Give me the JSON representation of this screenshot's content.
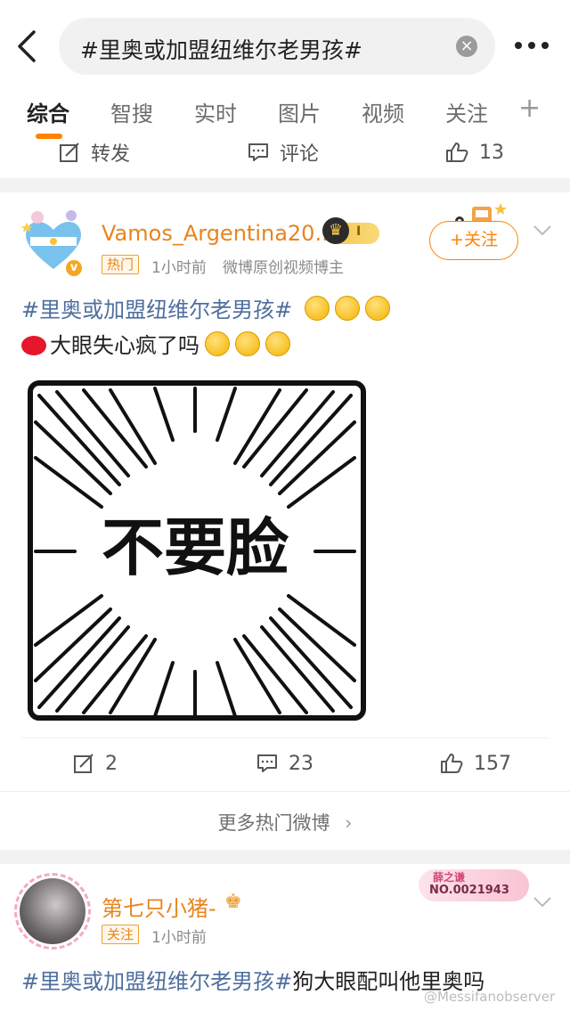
{
  "search": {
    "query": "#里奥或加盟纽维尔老男孩#",
    "clear_icon": "close-circle-icon"
  },
  "tabs": [
    {
      "label": "综合",
      "active": true
    },
    {
      "label": "智搜"
    },
    {
      "label": "实时"
    },
    {
      "label": "图片"
    },
    {
      "label": "视频"
    },
    {
      "label": "关注"
    }
  ],
  "prev_post_actions": {
    "repost": "转发",
    "comment": "评论",
    "likes": "13"
  },
  "post1": {
    "author": "Vamos_Argentina20...",
    "level_badge": "I",
    "tag": "热门",
    "time": "1小时前",
    "source": "微博原创视频博主",
    "follow_label": "+关注",
    "hashtag": "#里奥或加盟纽维尔老男孩#",
    "text": "大眼失心疯了吗",
    "meme_text": "不要脸",
    "reposts": "2",
    "comments": "23",
    "likes": "157"
  },
  "more_hot": "更多热门微博",
  "post2": {
    "author": "第七只小猪-",
    "tag": "关注",
    "time": "1小时前",
    "fan_badge_name": "薛之谦",
    "fan_badge_no": "NO.0021943",
    "hashtag": "#里奥或加盟纽维尔老男孩#",
    "text": "狗大眼配叫他里奥吗"
  },
  "watermark": "@Messifanobserver",
  "colors": {
    "accent": "#ff8200",
    "hashtag_blue": "#4e6e9e",
    "name_orange": "#e8841e"
  }
}
